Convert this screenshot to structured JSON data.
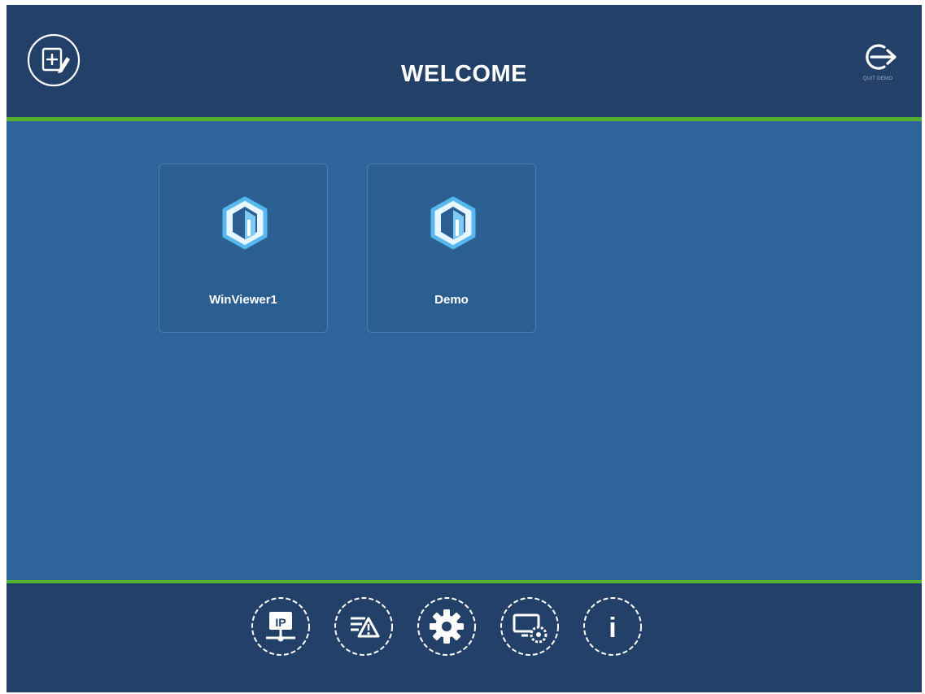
{
  "header": {
    "title": "WELCOME",
    "quit_label": "QUIT DEMO"
  },
  "tiles": [
    {
      "label": "WinViewer1",
      "icon": "hexagon-building-icon"
    },
    {
      "label": "Demo",
      "icon": "hexagon-building-icon"
    }
  ],
  "footer": {
    "buttons": [
      {
        "name": "ip-settings",
        "icon": "ip-network-icon",
        "text": "IP"
      },
      {
        "name": "alarm-log",
        "icon": "alarm-list-icon"
      },
      {
        "name": "settings",
        "icon": "gear-icon"
      },
      {
        "name": "display-settings",
        "icon": "monitor-gear-icon"
      },
      {
        "name": "info",
        "icon": "info-icon",
        "text": "i"
      }
    ]
  },
  "colors": {
    "header_bg": "#224068",
    "body_bg": "#2e6499",
    "accent_line": "#56b332",
    "icon_stroke": "#ffffff",
    "hex_icon": "#57b8ee"
  }
}
